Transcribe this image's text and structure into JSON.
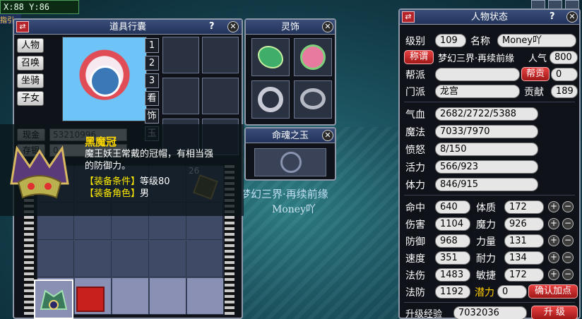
{
  "hud": {
    "coords": "X:88  Y:86",
    "top_mark": "指引"
  },
  "inventory": {
    "title": "道具行囊",
    "help": "?",
    "close": "✕",
    "swap": "⇄",
    "side_tabs": [
      "人物",
      "召唤",
      "坐骑",
      "子女"
    ],
    "page_tabs": [
      "1",
      "2",
      "3"
    ],
    "vtabs": [
      "看",
      "饰",
      "玉"
    ],
    "money_label": "现金",
    "money_value": "53210996",
    "savings_label": "存银",
    "savings_value": "0",
    "item_count": "26"
  },
  "tooltip": {
    "name": "黑魔冠",
    "desc": "魔王妖王常戴的冠帽，有相当强的防御力。",
    "req_label": "【装备条件】",
    "req_value": "等级80",
    "role_label": "【装备角色】",
    "role_value": "男"
  },
  "lingshi": {
    "title": "灵饰",
    "close": "✕"
  },
  "mingzhu": {
    "title": "命魂之玉",
    "close": "✕"
  },
  "world_text": {
    "line1": "梦幻三界·再续前缘",
    "line2": "Money吖"
  },
  "status": {
    "title": "人物状态",
    "help": "?",
    "close": "✕",
    "swap": "⇄",
    "level_label": "级别",
    "level": "109",
    "name_label": "名称",
    "name": "Money吖",
    "title_btn": "称谓",
    "title_value": "梦幻三界·再续前缘",
    "popularity_label": "人气",
    "popularity": "800",
    "gang_label": "帮派",
    "gang": "",
    "gang_contrib_btn": "帮贡",
    "gang_contrib": "0",
    "school_label": "门派",
    "school": "龙宫",
    "contrib_label": "贡献",
    "contrib": "189",
    "hp_label": "气血",
    "hp": "2682/2722/5388",
    "mp_label": "魔法",
    "mp": "7033/7970",
    "anger_label": "愤怒",
    "anger": "8/150",
    "vitality_label": "活力",
    "vitality": "566/923",
    "stamina_label": "体力",
    "stamina": "846/915",
    "left_stats": [
      {
        "label": "命中",
        "value": "640"
      },
      {
        "label": "伤害",
        "value": "1104"
      },
      {
        "label": "防御",
        "value": "968"
      },
      {
        "label": "速度",
        "value": "351"
      },
      {
        "label": "法伤",
        "value": "1483"
      },
      {
        "label": "法防",
        "value": "1192"
      }
    ],
    "right_stats": [
      {
        "label": "体质",
        "value": "172"
      },
      {
        "label": "魔力",
        "value": "926"
      },
      {
        "label": "力量",
        "value": "131"
      },
      {
        "label": "耐力",
        "value": "134"
      },
      {
        "label": "敏捷",
        "value": "172"
      }
    ],
    "potential_label": "潜力",
    "potential": "0",
    "confirm_btn": "确认加点",
    "exp_label": "升级经验",
    "exp": "7032036",
    "levelup_btn": "升 级",
    "plus": "+",
    "minus": "−"
  }
}
